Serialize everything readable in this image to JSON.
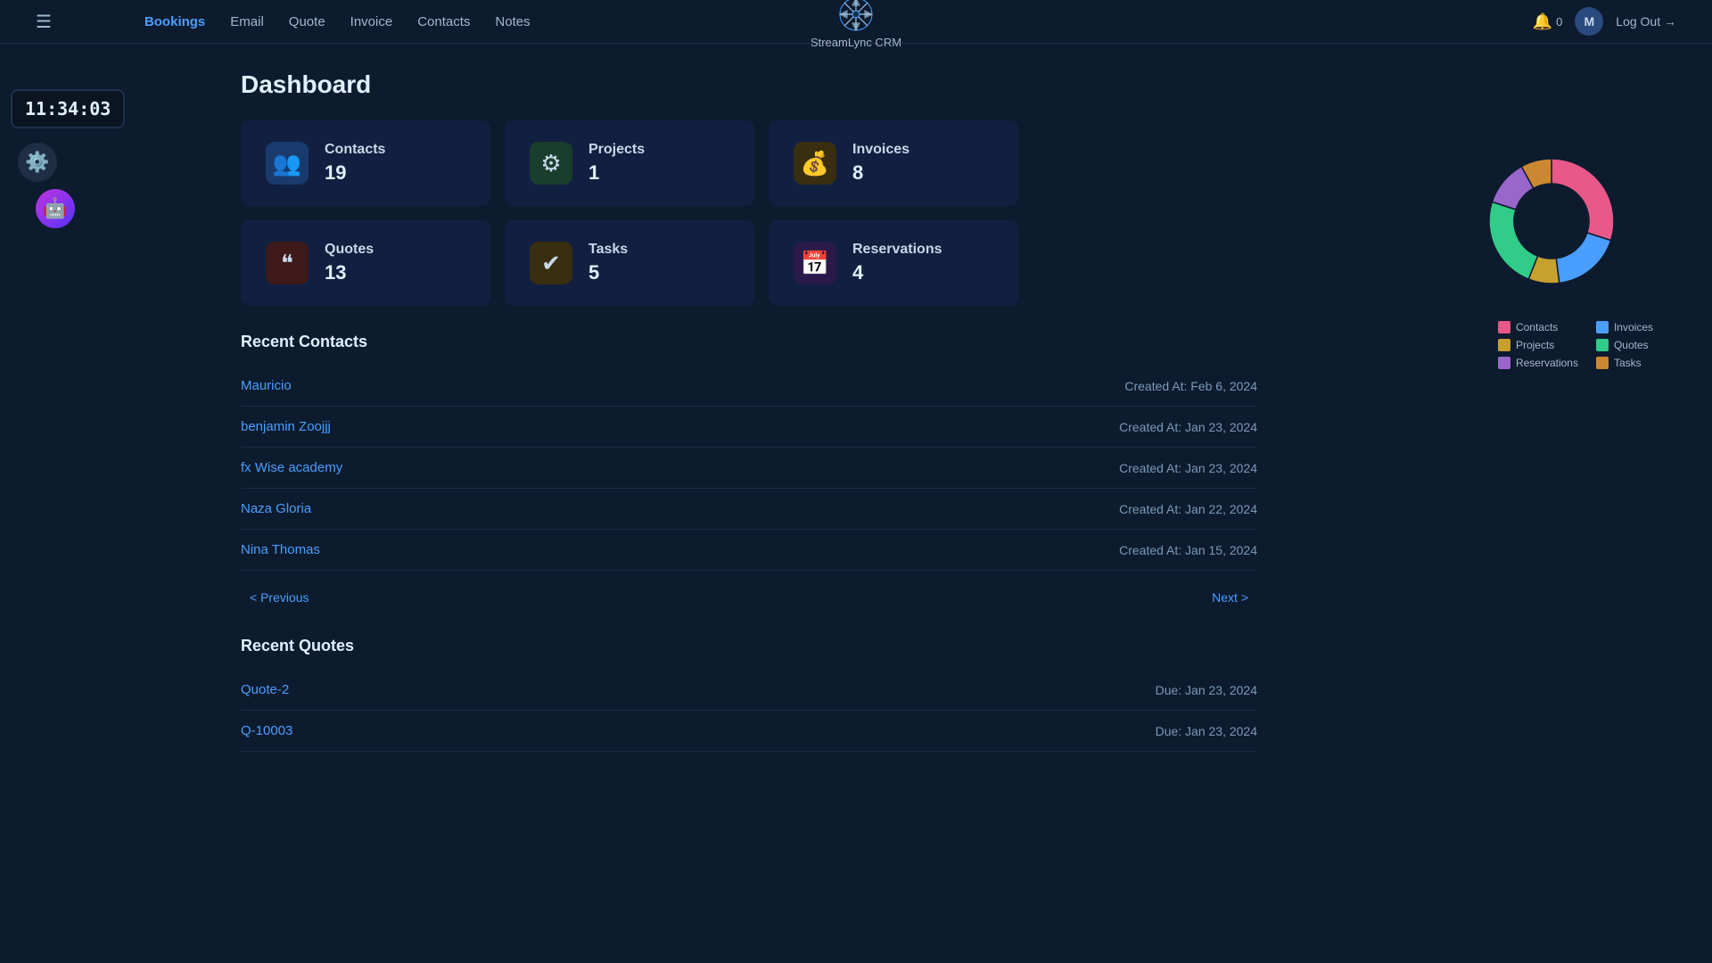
{
  "app": {
    "name": "StreamLync CRM",
    "logo_symbol": "❄"
  },
  "clock": {
    "time": "11:34:03"
  },
  "nav": {
    "hamburger": "☰",
    "links": [
      {
        "label": "Bookings",
        "active": true
      },
      {
        "label": "Email",
        "active": false
      },
      {
        "label": "Quote",
        "active": false
      },
      {
        "label": "Invoice",
        "active": false
      },
      {
        "label": "Contacts",
        "active": false
      },
      {
        "label": "Notes",
        "active": false
      }
    ],
    "bell_count": "0",
    "avatar_initial": "M",
    "logout": "Log Out →"
  },
  "page": {
    "title": "Dashboard"
  },
  "stats": [
    {
      "id": "contacts",
      "label": "Contacts",
      "count": "19",
      "icon": "👥",
      "icon_class": "contacts"
    },
    {
      "id": "projects",
      "label": "Projects",
      "count": "1",
      "icon": "⚙",
      "icon_class": "projects"
    },
    {
      "id": "invoices",
      "label": "Invoices",
      "count": "8",
      "icon": "💰",
      "icon_class": "invoices"
    },
    {
      "id": "quotes",
      "label": "Quotes",
      "count": "13",
      "icon": "❝",
      "icon_class": "quotes"
    },
    {
      "id": "tasks",
      "label": "Tasks",
      "count": "5",
      "icon": "✔",
      "icon_class": "tasks"
    },
    {
      "id": "reservations",
      "label": "Reservations",
      "count": "4",
      "icon": "📅",
      "icon_class": "reservations"
    }
  ],
  "chart": {
    "segments": [
      {
        "label": "Contacts",
        "color": "#e85888",
        "pct": 30
      },
      {
        "label": "Invoices",
        "color": "#4a9eff",
        "pct": 18
      },
      {
        "label": "Projects",
        "color": "#c8a030",
        "pct": 8
      },
      {
        "label": "Quotes",
        "color": "#30cc88",
        "pct": 24
      },
      {
        "label": "Reservations",
        "color": "#9966cc",
        "pct": 12
      },
      {
        "label": "Tasks",
        "color": "#cc8830",
        "pct": 8
      }
    ]
  },
  "recent_contacts": {
    "title": "Recent Contacts",
    "items": [
      {
        "name": "Mauricio",
        "created_at": "Created At: Feb 6, 2024"
      },
      {
        "name": "benjamin Zoojjj",
        "created_at": "Created At: Jan 23, 2024"
      },
      {
        "name": "fx Wise academy",
        "created_at": "Created At: Jan 23, 2024"
      },
      {
        "name": "Naza Gloria",
        "created_at": "Created At: Jan 22, 2024"
      },
      {
        "name": "Nina Thomas",
        "created_at": "Created At: Jan 15, 2024"
      }
    ],
    "prev_label": "< Previous",
    "next_label": "Next >"
  },
  "recent_quotes": {
    "title": "Recent Quotes",
    "items": [
      {
        "name": "Quote-2",
        "due": "Due: Jan 23, 2024"
      },
      {
        "name": "Q-10003",
        "due": "Due: Jan 23, 2024"
      }
    ]
  }
}
